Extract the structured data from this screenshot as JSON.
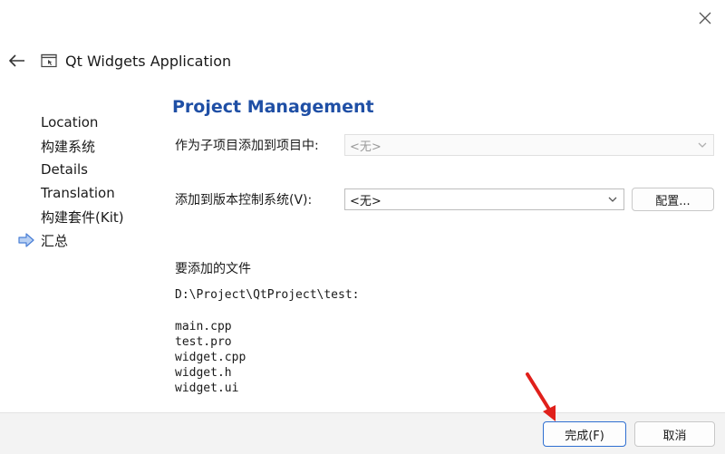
{
  "window": {
    "title": "Qt Widgets Application"
  },
  "sidebar": {
    "items": [
      {
        "label": "Location"
      },
      {
        "label": "构建系统"
      },
      {
        "label": "Details"
      },
      {
        "label": "Translation"
      },
      {
        "label": "构建套件(Kit)"
      },
      {
        "label": "汇总",
        "current": true
      }
    ]
  },
  "main": {
    "title": "Project Management",
    "subproject": {
      "label": "作为子项目添加到项目中:",
      "value": "<无>",
      "enabled": false
    },
    "vcs": {
      "label": "添加到版本控制系统(V):",
      "value": "<无>",
      "configure_label": "配置..."
    },
    "files": {
      "heading": "要添加的文件",
      "path": "D:\\Project\\QtProject\\test:",
      "list": [
        "main.cpp",
        "test.pro",
        "widget.cpp",
        "widget.h",
        "widget.ui"
      ]
    }
  },
  "footer": {
    "finish_label": "完成(F)",
    "cancel_label": "取消"
  },
  "colors": {
    "accent": "#1f4fa5",
    "current_arrow": "#4a7fd6",
    "annotation_arrow": "#e0201b",
    "focus_border": "#2f6fd1"
  },
  "icons": {
    "close": "close-icon",
    "back": "back-arrow-icon",
    "app": "qt-widgets-app-icon",
    "current_step": "current-step-arrow-icon",
    "dropdown": "chevron-down-icon"
  }
}
